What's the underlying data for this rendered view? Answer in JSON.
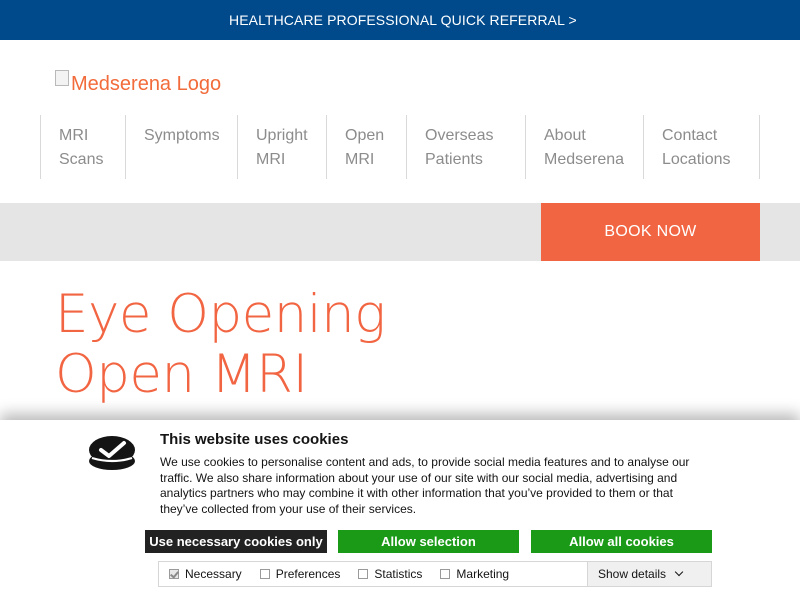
{
  "topbar": {
    "link": "HEALTHCARE PROFESSIONAL QUICK REFERRAL >"
  },
  "logo": {
    "alt": "Medserena Logo"
  },
  "nav": [
    {
      "line1": "MRI",
      "line2": "Scans"
    },
    {
      "line1": "Symptoms",
      "line2": ""
    },
    {
      "line1": "Upright",
      "line2": "MRI"
    },
    {
      "line1": "Open",
      "line2": "MRI"
    },
    {
      "line1": "Overseas",
      "line2": "Patients"
    },
    {
      "line1": "About",
      "line2": "Medserena"
    },
    {
      "line1": "Contact",
      "line2": "Locations"
    }
  ],
  "book_now": "BOOK NOW",
  "hero": {
    "line1": "Eye Opening",
    "line2": "Open MRI"
  },
  "cookie": {
    "title": "This website uses cookies",
    "description": "We use cookies to personalise content and ads, to provide social media features and to analyse our traffic. We also share information about your use of our site with our social media, advertising and analytics partners who may combine it with other information that you’ve provided to them or that they’ve collected from your use of their services.",
    "buttons": {
      "necessary_only": "Use necessary cookies only",
      "allow_selection": "Allow selection",
      "allow_all": "Allow all cookies"
    },
    "preferences": [
      {
        "label": "Necessary",
        "checked": true
      },
      {
        "label": "Preferences",
        "checked": false
      },
      {
        "label": "Statistics",
        "checked": false
      },
      {
        "label": "Marketing",
        "checked": false
      }
    ],
    "show_details": "Show details"
  },
  "colors": {
    "topbar": "#004a8c",
    "accent": "#f26542",
    "green": "#1a9a17",
    "dark": "#222222"
  }
}
